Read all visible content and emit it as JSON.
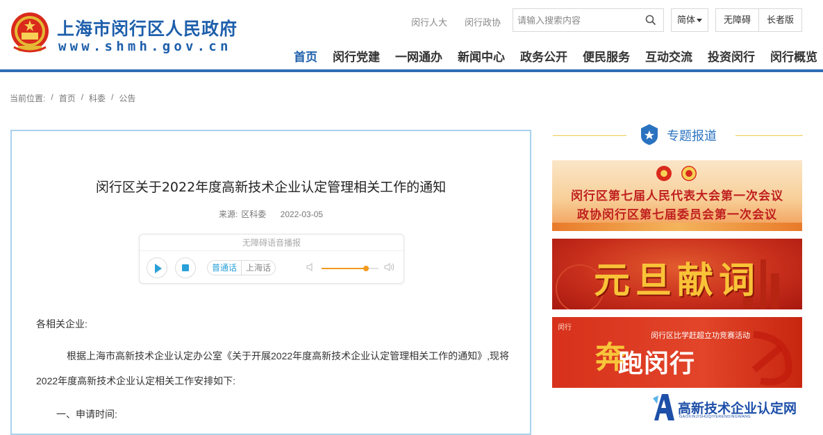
{
  "header": {
    "site_title": "上海市闵行区人民政府",
    "site_domain": "www.shmh.gov.cn",
    "top_links": [
      "闵行人大",
      "闵行政协"
    ],
    "search_placeholder": "请输入搜索内容",
    "language": "简体",
    "accessibility": [
      "无障碍",
      "长者版"
    ],
    "nav": [
      "首页",
      "闵行党建",
      "一网通办",
      "新闻中心",
      "政务公开",
      "便民服务",
      "互动交流",
      "投资闵行",
      "闵行概览"
    ],
    "nav_active_index": 0,
    "accent_color": "#1e5fab"
  },
  "breadcrumb": {
    "label": "当前位置:",
    "items": [
      "首页",
      "科委",
      "公告"
    ]
  },
  "article": {
    "title": "闵行区关于2022年度高新技术企业认定管理相关工作的通知",
    "source_label": "来源:",
    "source": "区科委",
    "date": "2022-03-05",
    "player": {
      "title": "无障碍语音播报",
      "dialects": [
        "普通话",
        "上海话"
      ],
      "active_dialect": "普通话",
      "volume": 0.78
    },
    "greeting": "各相关企业:",
    "body": "根据上海市高新技术企业认定办公室《关于开展2022年度高新技术企业认定管理相关工作的通知》,现将2022年度高新技术企业认定相关工作安排如下:",
    "section_1": "一、申请时间:"
  },
  "sidebar": {
    "topic_title": "专题报道",
    "banners": [
      {
        "lines": [
          "闵行区第七届人民代表大会第一次会议",
          "政协闵行区第七届委员会第一次会议"
        ]
      },
      {
        "title": "元旦献词"
      },
      {
        "caption": "闵行区比学赶超立功竞赛活动",
        "title": "跑闵行",
        "mark": "奔",
        "brand": "闵行"
      }
    ]
  },
  "watermark": {
    "text": "高新技术企业认定网",
    "sub": "GAOXINJISHUQIYERENDINGWANG"
  }
}
